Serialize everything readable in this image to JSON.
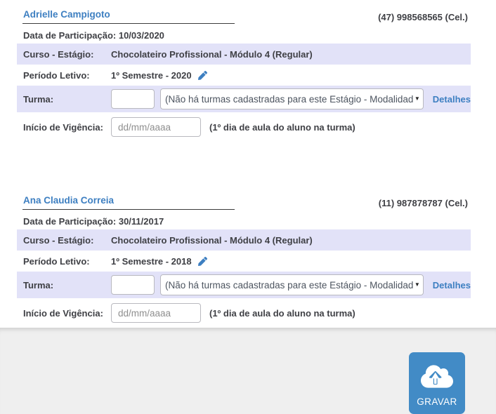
{
  "colors": {
    "accent_blue": "#3d7fc1",
    "row_highlight": "#e2e2f8",
    "button_blue": "#428bc6",
    "label_text": "#3f4045",
    "footer_bg": "#efefef"
  },
  "icons": {
    "dropdown_caret": "▼",
    "edit_pencil": "pencil-icon",
    "cloud_upload": "cloud-upload-icon"
  },
  "records": [
    {
      "name": "Adrielle Campigoto",
      "phone": "(47) 998568565 (Cel.)",
      "participation": {
        "label": "Data de Participação:",
        "value": "10/03/2020"
      },
      "course": {
        "label": "Curso - Estágio:",
        "value": "Chocolateiro Profissional - Módulo 4 (Regular)"
      },
      "period": {
        "label": "Período Letivo:",
        "value": "1º Semestre - 2020"
      },
      "turma": {
        "label": "Turma:",
        "code_value": "",
        "select_value": "(Não há turmas cadastradas para este Estágio - Modalidad",
        "details_label": "Detalhes"
      },
      "vigencia": {
        "label": "Início de Vigência:",
        "placeholder": "dd/mm/aaaa",
        "value": "",
        "hint": "(1º dia de aula do aluno na turma)"
      }
    },
    {
      "name": "Ana Claudia Correia",
      "phone": "(11) 987878787 (Cel.)",
      "participation": {
        "label": "Data de Participação:",
        "value": "30/11/2017"
      },
      "course": {
        "label": "Curso - Estágio:",
        "value": "Chocolateiro Profissional - Módulo 4 (Regular)"
      },
      "period": {
        "label": "Período Letivo:",
        "value": "1º Semestre - 2018"
      },
      "turma": {
        "label": "Turma:",
        "code_value": "",
        "select_value": "(Não há turmas cadastradas para este Estágio - Modalidad",
        "details_label": "Detalhes"
      },
      "vigencia": {
        "label": "Início de Vigência:",
        "placeholder": "dd/mm/aaaa",
        "value": "",
        "hint": "(1º dia de aula do aluno na turma)"
      }
    }
  ],
  "footer": {
    "save_label": "GRAVAR"
  }
}
